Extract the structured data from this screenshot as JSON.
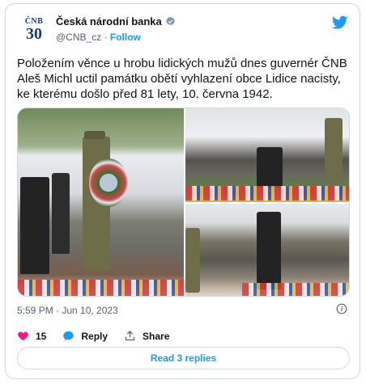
{
  "author": {
    "name": "Česká národní banka",
    "handle": "@CNB_cz",
    "separator": "·",
    "follow_label": "Follow",
    "avatar_line1": "ČNB",
    "avatar_line2": "30",
    "verified_color": "#829aab"
  },
  "tweet": {
    "text": "Položením věnce u hrobu lidických mužů dnes guvernér ČNB Aleš Michl uctil památku obětí vyhlazení obce Lidice nacisty, ke kterému došlo před 81 lety, 10. června 1942.",
    "timestamp": "5:59 PM · Jun 10, 2023",
    "photos": [
      {
        "label": "photo-wreath-laying"
      },
      {
        "label": "photo-kneeling"
      },
      {
        "label": "photo-standing"
      }
    ]
  },
  "actions": {
    "likes_count": "15",
    "reply_label": "Reply",
    "share_label": "Share",
    "like_color": "#f91880",
    "reply_color": "#1d9bf0"
  },
  "replies_button": "Read 3 replies",
  "colors": {
    "accent": "#1d9bf0",
    "border": "#cfd9de",
    "muted": "#536471"
  }
}
